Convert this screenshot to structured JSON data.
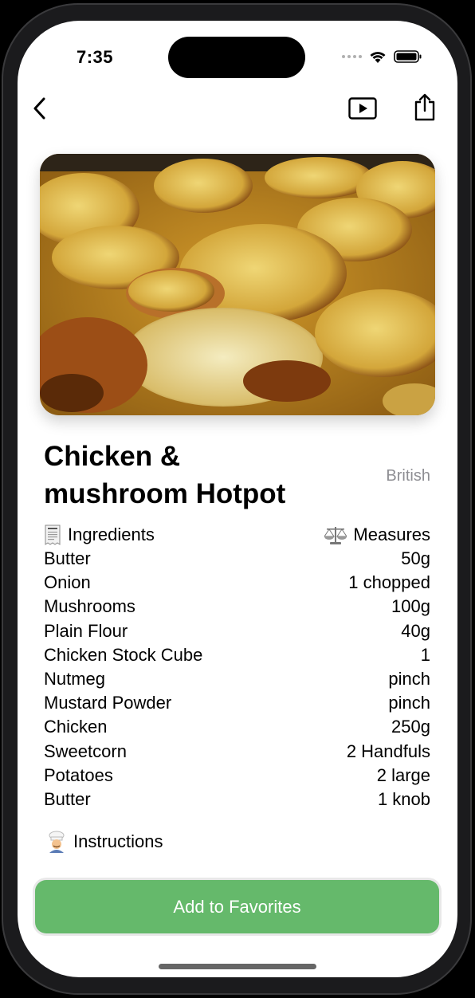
{
  "status_bar": {
    "time": "7:35"
  },
  "nav": {
    "back_icon": "chevron-left-icon",
    "play_icon": "play-rectangle-icon",
    "share_icon": "share-icon"
  },
  "recipe": {
    "title": "Chicken & mushroom Hotpot",
    "cuisine": "British",
    "ingredients_header": "Ingredients",
    "measures_header": "Measures",
    "ingredients": [
      {
        "name": "Butter",
        "measure": "50g"
      },
      {
        "name": "Onion",
        "measure": "1 chopped"
      },
      {
        "name": "Mushrooms",
        "measure": "100g"
      },
      {
        "name": "Plain Flour",
        "measure": "40g"
      },
      {
        "name": "Chicken Stock Cube",
        "measure": "1"
      },
      {
        "name": "Nutmeg",
        "measure": "pinch"
      },
      {
        "name": "Mustard Powder",
        "measure": "pinch"
      },
      {
        "name": "Chicken",
        "measure": "250g"
      },
      {
        "name": "Sweetcorn",
        "measure": "2 Handfuls"
      },
      {
        "name": "Potatoes",
        "measure": "2 large"
      },
      {
        "name": "Butter",
        "measure": "1 knob"
      }
    ],
    "instructions_label": "Instructions"
  },
  "actions": {
    "favorite_label": "Add to Favorites"
  },
  "colors": {
    "accent": "#65b96b",
    "secondary_text": "#8e8e93"
  }
}
